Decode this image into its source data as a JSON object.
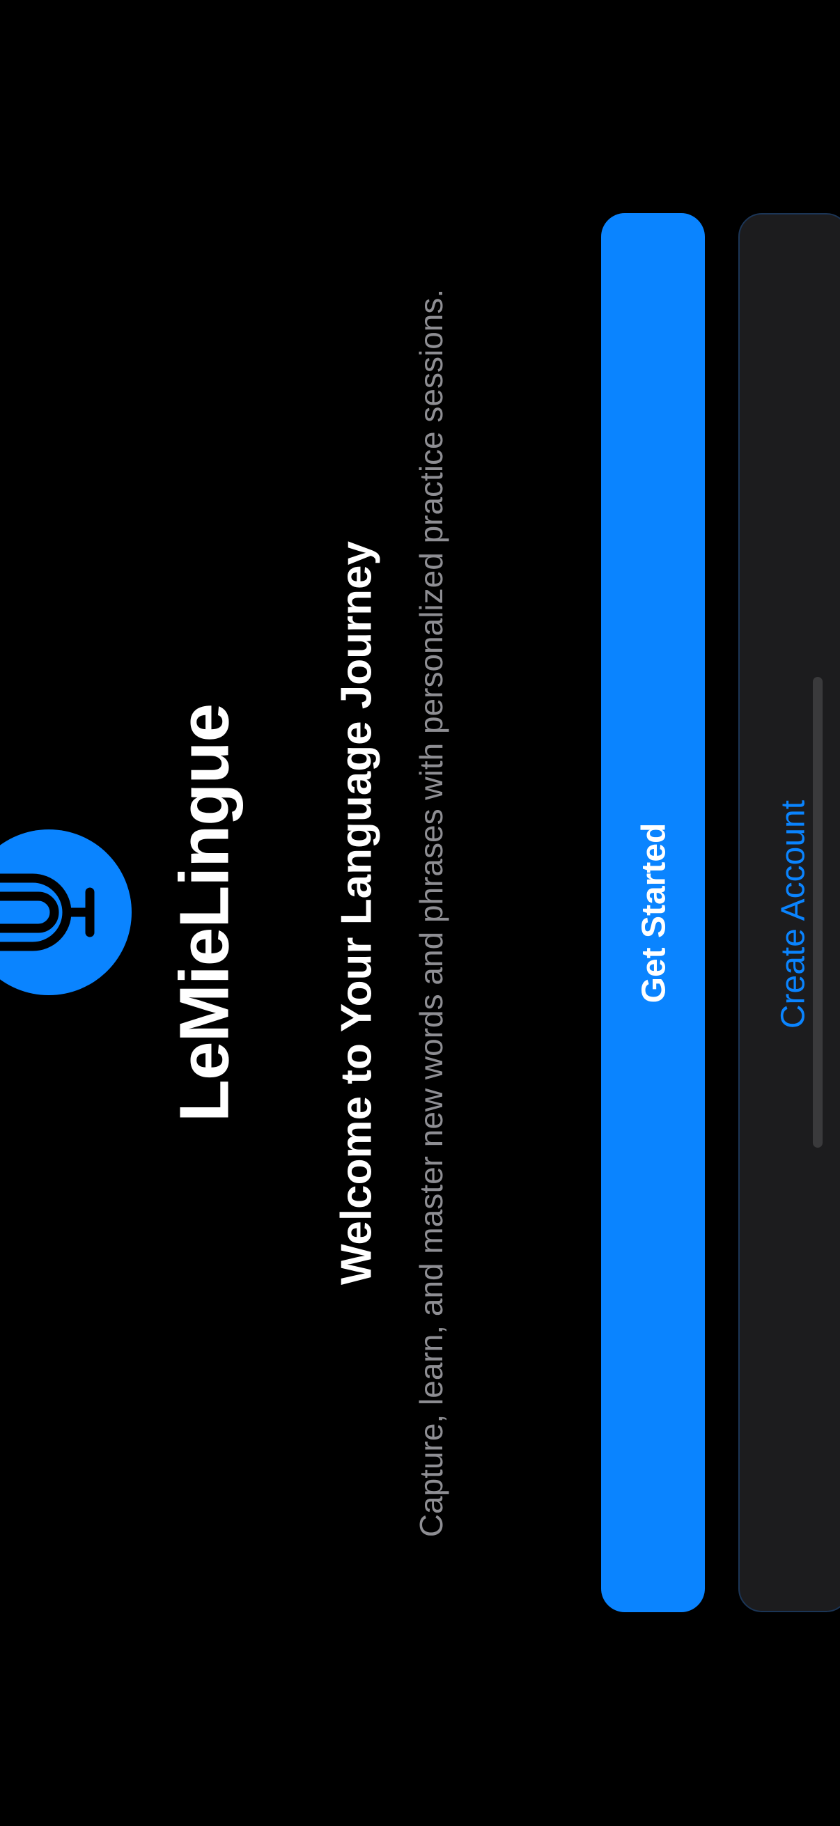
{
  "app": {
    "name": "LeMieLingue",
    "logo_icon": "microphone-icon",
    "accent_color": "#0a84ff"
  },
  "welcome": {
    "heading": "Welcome to Your Language Journey",
    "tagline": "Capture, learn, and master new words and phrases with personalized practice sessions."
  },
  "actions": {
    "primary_label": "Get Started",
    "secondary_label": "Create Account"
  }
}
